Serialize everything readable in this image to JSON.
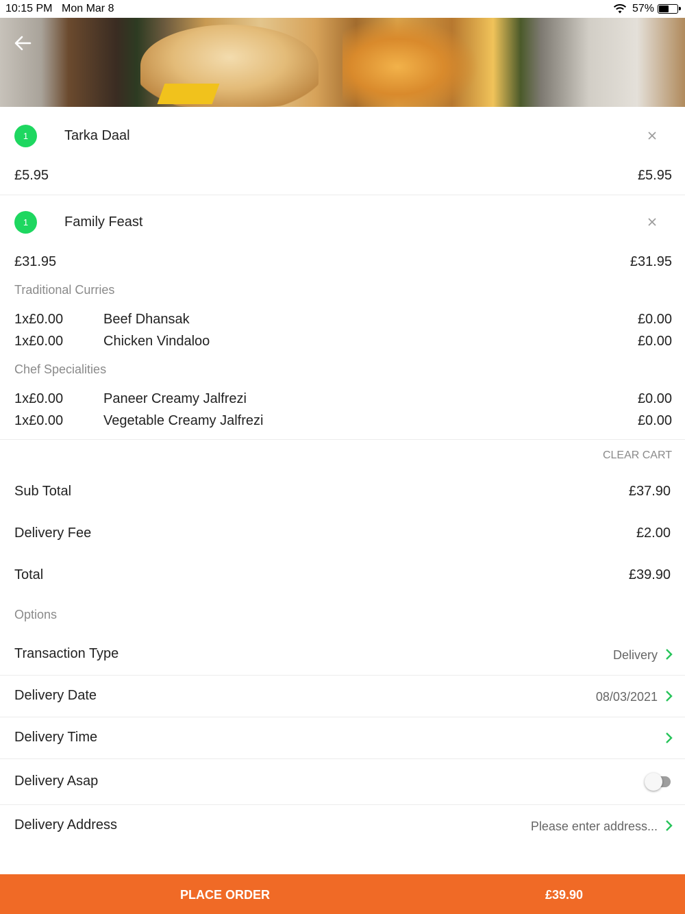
{
  "status_bar": {
    "time": "10:15 PM",
    "date": "Mon Mar 8",
    "battery": "57%",
    "battery_level": 0.57
  },
  "cart": {
    "items": [
      {
        "qty": "1",
        "name": "Tarka Daal",
        "unit_price": "£5.95",
        "total": "£5.95",
        "groups": []
      },
      {
        "qty": "1",
        "name": "Family Feast",
        "unit_price": "£31.95",
        "total": "£31.95",
        "groups": [
          {
            "title": "Traditional Curries",
            "lines": [
              {
                "qty_price": "1x£0.00",
                "name": "Beef Dhansak",
                "price": "£0.00"
              },
              {
                "qty_price": "1x£0.00",
                "name": "Chicken Vindaloo",
                "price": "£0.00"
              }
            ]
          },
          {
            "title": "Chef Specialities",
            "lines": [
              {
                "qty_price": "1x£0.00",
                "name": "Paneer Creamy Jalfrezi",
                "price": "£0.00"
              },
              {
                "qty_price": "1x£0.00",
                "name": "Vegetable Creamy Jalfrezi",
                "price": "£0.00"
              }
            ]
          }
        ]
      }
    ],
    "clear_label": "CLEAR CART"
  },
  "summary": {
    "sub_total_label": "Sub Total",
    "sub_total": "£37.90",
    "delivery_fee_label": "Delivery Fee",
    "delivery_fee": "£2.00",
    "total_label": "Total",
    "total": "£39.90"
  },
  "options": {
    "title": "Options",
    "transaction_type_label": "Transaction Type",
    "transaction_type": "Delivery",
    "delivery_date_label": "Delivery Date",
    "delivery_date": "08/03/2021",
    "delivery_time_label": "Delivery Time",
    "delivery_time": "",
    "delivery_asap_label": "Delivery Asap",
    "delivery_asap": false,
    "delivery_address_label": "Delivery Address",
    "delivery_address": "Please enter address..."
  },
  "footer": {
    "place_order_label": "PLACE ORDER",
    "amount": "£39.90"
  },
  "colors": {
    "accent_green": "#1ed760",
    "chevron_green": "#27c45a",
    "order_orange": "#f06a26"
  }
}
